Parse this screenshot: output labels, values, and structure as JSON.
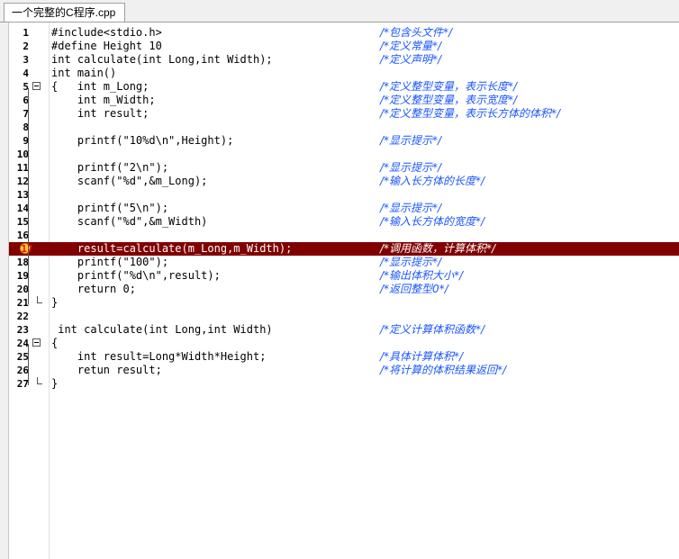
{
  "tab": {
    "filename": "一个完整的C程序.cpp"
  },
  "lines": [
    {
      "n": "1",
      "code": "#include<stdio.h>",
      "comment": "/*包含头文件*/"
    },
    {
      "n": "2",
      "code": "#define Height 10",
      "comment": "/*定义常量*/"
    },
    {
      "n": "3",
      "code": "int calculate(int Long,int Width);",
      "comment": "/*定义声明*/"
    },
    {
      "n": "4",
      "code": "int main()",
      "comment": ""
    },
    {
      "n": "5",
      "code": "{   int m_Long;",
      "comment": "/*定义整型变量，表示长度*/"
    },
    {
      "n": "6",
      "code": "    int m_Width;",
      "comment": "/*定义整型变量，表示宽度*/"
    },
    {
      "n": "7",
      "code": "    int result;",
      "comment": "/*定义整型变量，表示长方体的体积*/"
    },
    {
      "n": "8",
      "code": "",
      "comment": ""
    },
    {
      "n": "9",
      "code": "    printf(\"10%d\\n\",Height);",
      "comment": "/*显示提示*/"
    },
    {
      "n": "10",
      "code": "",
      "comment": ""
    },
    {
      "n": "11",
      "code": "    printf(\"2\\n\");",
      "comment": "/*显示提示*/"
    },
    {
      "n": "12",
      "code": "    scanf(\"%d\",&m_Long);",
      "comment": "/*输入长方体的长度*/"
    },
    {
      "n": "13",
      "code": "",
      "comment": ""
    },
    {
      "n": "14",
      "code": "    printf(\"5\\n\");",
      "comment": "/*显示提示*/"
    },
    {
      "n": "15",
      "code": "    scanf(\"%d\",&m_Width)",
      "comment": "/*输入长方体的宽度*/"
    },
    {
      "n": "16",
      "code": "",
      "comment": ""
    },
    {
      "n": "17",
      "code": "    result=calculate(m_Long,m_Width);",
      "comment": "/*调用函数，计算体积*/"
    },
    {
      "n": "18",
      "code": "    printf(\"100\");",
      "comment": "/*显示提示*/"
    },
    {
      "n": "19",
      "code": "    printf(\"%d\\n\",result);",
      "comment": "/*输出体积大小*/"
    },
    {
      "n": "20",
      "code": "    return 0;",
      "comment": "/*返回整型0*/"
    },
    {
      "n": "21",
      "code": "}",
      "comment": ""
    },
    {
      "n": "22",
      "code": "",
      "comment": ""
    },
    {
      "n": "23",
      "code": " int calculate(int Long,int Width)",
      "comment": "/*定义计算体积函数*/"
    },
    {
      "n": "24",
      "code": "{",
      "comment": ""
    },
    {
      "n": "25",
      "code": "    int result=Long*Width*Height;",
      "comment": "/*具体计算体积*/"
    },
    {
      "n": "26",
      "code": "    retun result;",
      "comment": "/*将计算的体积结果返回*/"
    },
    {
      "n": "27",
      "code": "}",
      "comment": ""
    }
  ],
  "highlight_line": "17",
  "breakpoint_icon": "breakpoint-icon",
  "colors": {
    "comment": "#1a55ff",
    "highlight": "#800000"
  }
}
